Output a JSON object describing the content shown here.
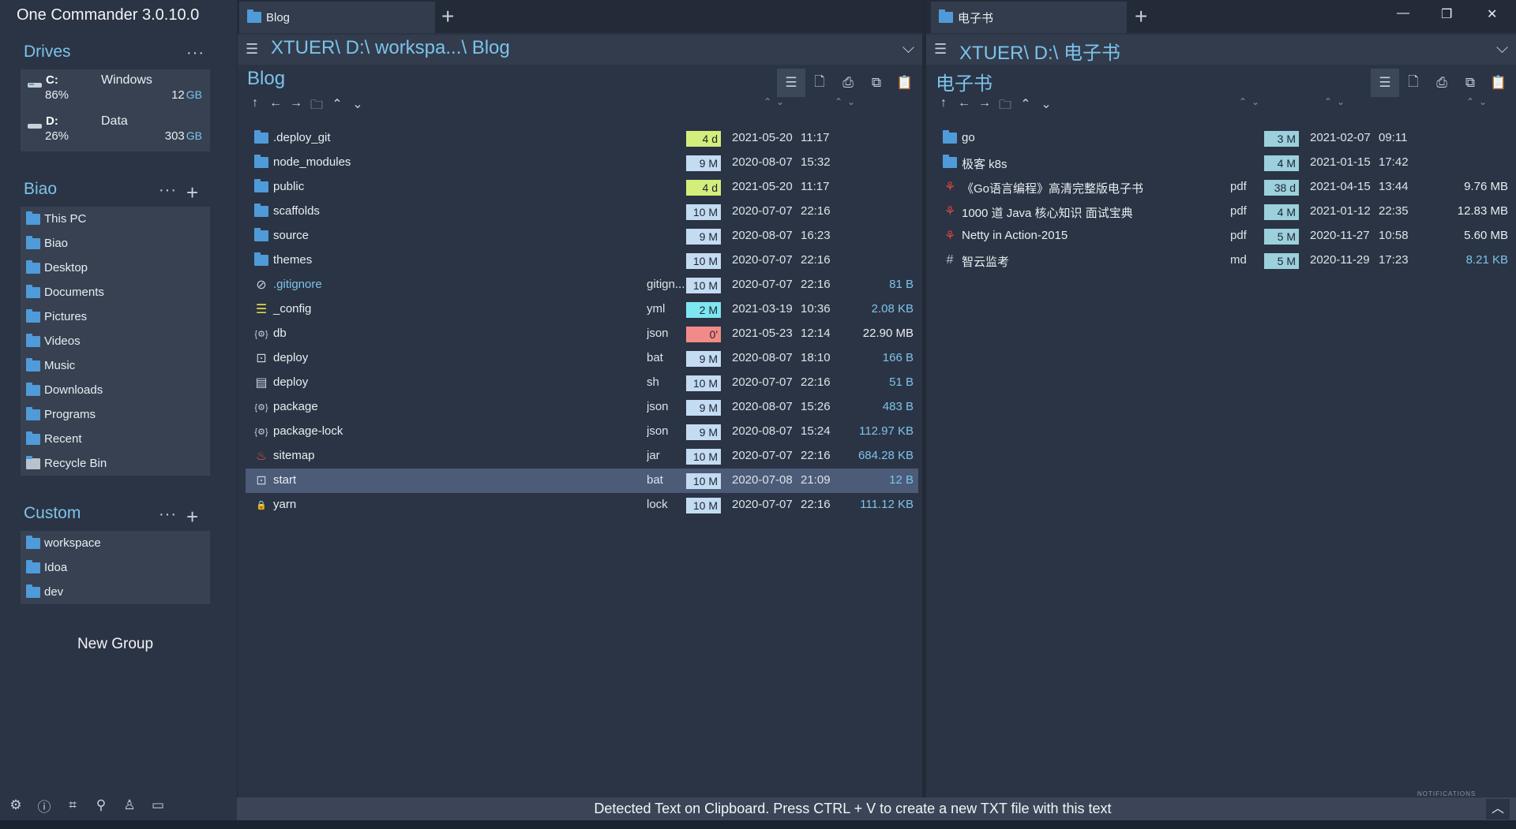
{
  "app": {
    "title": "One Commander 3.0.10.0"
  },
  "sidebar": {
    "drives": {
      "title": "Drives",
      "dots": "···",
      "items": [
        {
          "letter": "C:",
          "name": "Windows",
          "used_pct": "86%",
          "free": "12",
          "unit": "GB"
        },
        {
          "letter": "D:",
          "name": "Data",
          "used_pct": "26%",
          "free": "303",
          "unit": "GB"
        }
      ]
    },
    "biao": {
      "title": "Biao",
      "dots": "···",
      "plus": "+",
      "items": [
        {
          "label": "This PC"
        },
        {
          "label": "Biao"
        },
        {
          "label": "Desktop"
        },
        {
          "label": "Documents"
        },
        {
          "label": "Pictures"
        },
        {
          "label": "Videos"
        },
        {
          "label": "Music"
        },
        {
          "label": "Downloads"
        },
        {
          "label": "Programs"
        },
        {
          "label": "Recent"
        },
        {
          "label": "Recycle Bin"
        }
      ]
    },
    "custom": {
      "title": "Custom",
      "dots": "···",
      "plus": "+",
      "items": [
        {
          "label": "workspace"
        },
        {
          "label": "Idoa"
        },
        {
          "label": "dev"
        }
      ]
    },
    "new_group": "New Group"
  },
  "left_pane": {
    "tab": "Blog",
    "plus": "+",
    "path": "XTUER\\ D:\\ workspa...\\ Blog",
    "folder_title": "Blog",
    "files": [
      {
        "name": ".deploy_git",
        "type": "folder",
        "ext": "",
        "age": "4 d",
        "age_color": "lime",
        "date": "2021-05-20",
        "time": "11:17",
        "size": ""
      },
      {
        "name": "node_modules",
        "type": "folder",
        "ext": "",
        "age": "9 M",
        "age_color": "ice",
        "date": "2020-08-07",
        "time": "15:32",
        "size": ""
      },
      {
        "name": "public",
        "type": "folder",
        "ext": "",
        "age": "4 d",
        "age_color": "lime",
        "date": "2021-05-20",
        "time": "11:17",
        "size": ""
      },
      {
        "name": "scaffolds",
        "type": "folder",
        "ext": "",
        "age": "10 M",
        "age_color": "ice",
        "date": "2020-07-07",
        "time": "22:16",
        "size": ""
      },
      {
        "name": "source",
        "type": "folder",
        "ext": "",
        "age": "9 M",
        "age_color": "ice",
        "date": "2020-08-07",
        "time": "16:23",
        "size": ""
      },
      {
        "name": "themes",
        "type": "folder",
        "ext": "",
        "age": "10 M",
        "age_color": "ice",
        "date": "2020-07-07",
        "time": "22:16",
        "size": ""
      },
      {
        "name": ".gitignore",
        "type": "ignore",
        "ext": "gitign...",
        "age": "10 M",
        "age_color": "ice",
        "date": "2020-07-07",
        "time": "22:16",
        "size": "81 B"
      },
      {
        "name": "_config",
        "type": "config",
        "ext": "yml",
        "age": "2 M",
        "age_color": "cyan",
        "date": "2021-03-19",
        "time": "10:36",
        "size": "2.08 KB"
      },
      {
        "name": "db",
        "type": "json",
        "ext": "json",
        "age": "0'",
        "age_color": "red",
        "date": "2021-05-23",
        "time": "12:14",
        "size": "22.90 MB"
      },
      {
        "name": "deploy",
        "type": "bat",
        "ext": "bat",
        "age": "9 M",
        "age_color": "ice",
        "date": "2020-08-07",
        "time": "18:10",
        "size": "166 B"
      },
      {
        "name": "deploy",
        "type": "sh",
        "ext": "sh",
        "age": "10 M",
        "age_color": "ice",
        "date": "2020-07-07",
        "time": "22:16",
        "size": "51 B"
      },
      {
        "name": "package",
        "type": "json",
        "ext": "json",
        "age": "9 M",
        "age_color": "ice",
        "date": "2020-08-07",
        "time": "15:26",
        "size": "483 B"
      },
      {
        "name": "package-lock",
        "type": "json",
        "ext": "json",
        "age": "9 M",
        "age_color": "ice",
        "date": "2020-08-07",
        "time": "15:24",
        "size": "112.97 KB"
      },
      {
        "name": "sitemap",
        "type": "jar",
        "ext": "jar",
        "age": "10 M",
        "age_color": "ice",
        "date": "2020-07-07",
        "time": "22:16",
        "size": "684.28 KB"
      },
      {
        "name": "start",
        "type": "bat",
        "ext": "bat",
        "age": "10 M",
        "age_color": "ice",
        "date": "2020-07-08",
        "time": "21:09",
        "size": "12 B",
        "selected": true
      },
      {
        "name": "yarn",
        "type": "lock",
        "ext": "lock",
        "age": "10 M",
        "age_color": "ice",
        "date": "2020-07-07",
        "time": "22:16",
        "size": "111.12 KB"
      }
    ]
  },
  "right_pane": {
    "tab": "电子书",
    "plus": "+",
    "path": "XTUER\\ D:\\ 电子书",
    "folder_title": "电子书",
    "files": [
      {
        "name": "go",
        "type": "folder",
        "ext": "",
        "age": "3 M",
        "age_color": "teal",
        "date": "2021-02-07",
        "time": "09:11",
        "size": ""
      },
      {
        "name": "极客 k8s",
        "type": "folder",
        "ext": "",
        "age": "4 M",
        "age_color": "teal",
        "date": "2021-01-15",
        "time": "17:42",
        "size": ""
      },
      {
        "name": "《Go语言编程》高清完整版电子书",
        "type": "pdf",
        "ext": "pdf",
        "age": "38 d",
        "age_color": "teal",
        "date": "2021-04-15",
        "time": "13:44",
        "size": "9.76 MB"
      },
      {
        "name": "1000 道 Java 核心知识 面试宝典",
        "type": "pdf",
        "ext": "pdf",
        "age": "4 M",
        "age_color": "teal",
        "date": "2021-01-12",
        "time": "22:35",
        "size": "12.83 MB"
      },
      {
        "name": "Netty in Action-2015",
        "type": "pdf",
        "ext": "pdf",
        "age": "5 M",
        "age_color": "teal",
        "date": "2020-11-27",
        "time": "10:58",
        "size": "5.60 MB"
      },
      {
        "name": "智云监考",
        "type": "md",
        "ext": "md",
        "age": "5 M",
        "age_color": "teal",
        "date": "2020-11-29",
        "time": "17:23",
        "size": "8.21 KB"
      }
    ]
  },
  "window": {
    "minimize": "—",
    "restore": "❐",
    "close": "✕"
  },
  "status": {
    "message": "Detected Text on Clipboard. Press CTRL + V to create a new TXT file with this text",
    "notifications": "NOTIFICATIONS",
    "up": "︿"
  },
  "colors": {
    "accent": "#7cc3ea",
    "background": "#2b3444",
    "panel": "#374152",
    "selected_row": "#4b5b78",
    "folder": "#4f9bd9"
  }
}
